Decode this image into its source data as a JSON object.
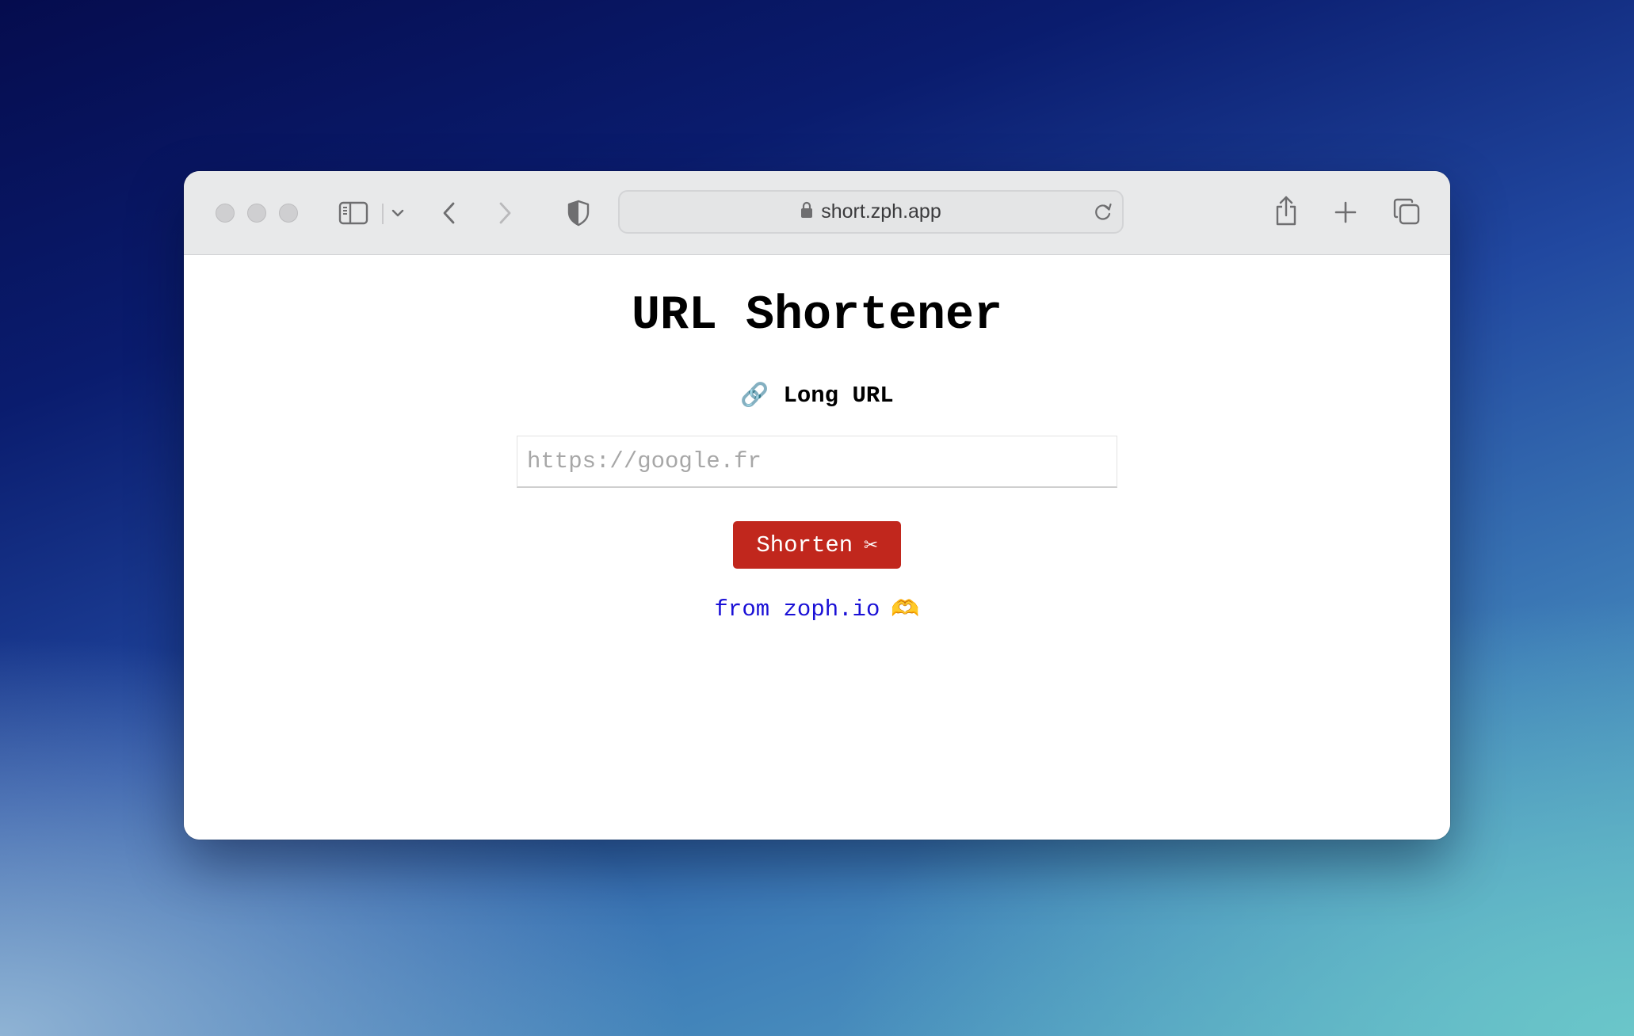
{
  "browser": {
    "address": "short.zph.app",
    "icons": {
      "sidebar": "sidebar-icon",
      "dropdown": "chevron-down-icon",
      "back": "chevron-left-icon",
      "forward": "chevron-right-icon",
      "privacy": "shield-icon",
      "lock": "lock-icon",
      "reload": "reload-icon",
      "share": "share-icon",
      "new_tab": "plus-icon",
      "tabs_overview": "tabs-icon"
    }
  },
  "page": {
    "title": "URL Shortener",
    "field_label": "Long URL",
    "field_label_icon": "🔗",
    "input_value": "",
    "input_placeholder": "https://google.fr",
    "button_label": "Shorten",
    "button_icon": "✂",
    "footer_link": "from zoph.io",
    "footer_icon": "🫶"
  },
  "colors": {
    "button": "#c1271d",
    "link": "#1a10d6"
  }
}
